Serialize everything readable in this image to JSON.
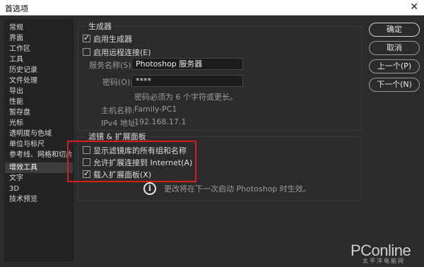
{
  "window": {
    "title": "首选项",
    "close_glyph": "✕"
  },
  "sidebar": {
    "items": [
      "常规",
      "界面",
      "工作区",
      "工具",
      "历史记录",
      "文件处理",
      "导出",
      "性能",
      "暂存盘",
      "光标",
      "透明度与色域",
      "单位与标尺",
      "参考线、网格和切片",
      "增效工具",
      "文字",
      "3D",
      "技术预览"
    ],
    "active_index": 13
  },
  "generator": {
    "title": "生成器",
    "enable_generator": {
      "label": "启用生成器",
      "checked": true
    },
    "enable_remote": {
      "label": "启用远程连接(E)",
      "checked": false
    },
    "service_name_label": "服务名称(S):",
    "service_name_value": "Photoshop 服务器",
    "password_label": "密码(O):",
    "password_value": "****",
    "password_hint": "密码必须为 6 个字符或更长。",
    "hostname_label": "主机名称:",
    "hostname_value": "Family-PC1",
    "ipv4_label": "IPv4 地址:",
    "ipv4_value": "192.168.17.1"
  },
  "filters": {
    "title": "滤镜 & 扩展面板",
    "show_all_filters": {
      "label": "显示滤镜库的所有组和名称",
      "checked": false
    },
    "allow_internet": {
      "label": "允许扩展连接到 Internet(A)",
      "checked": false
    },
    "load_panels": {
      "label": "载入扩展面板(X)",
      "checked": true
    },
    "notice": "更改将在下一次启动 Photoshop 时生效。",
    "info_glyph": "i"
  },
  "buttons": {
    "ok": "确定",
    "cancel": "取消",
    "prev": "上一个(P)",
    "next": "下一个(N)"
  },
  "watermark": {
    "brand": "PConline",
    "sub": "太平洋电脑网"
  },
  "colors": {
    "background": "#2b2b2b",
    "highlight": "#d7201c"
  }
}
